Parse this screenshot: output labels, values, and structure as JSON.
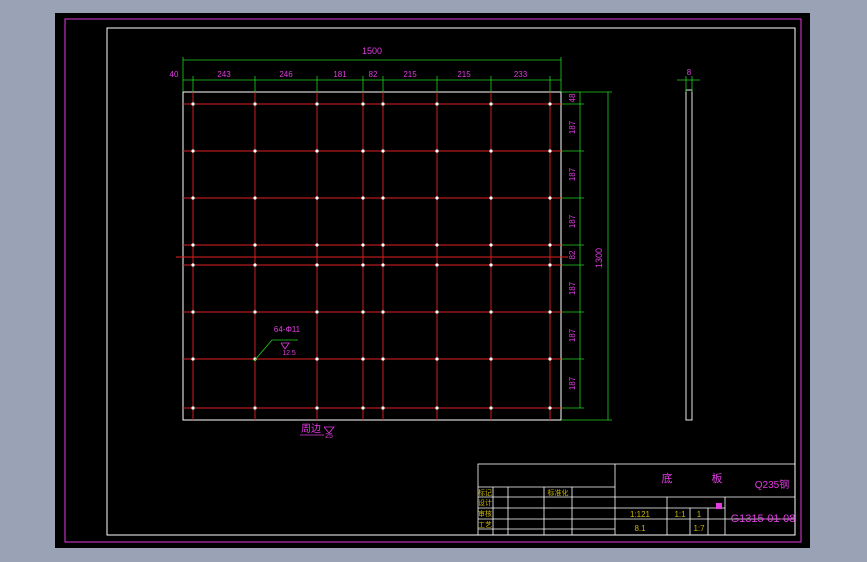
{
  "colors": {
    "background": "#9aa3b5",
    "paper": "#000000",
    "magenta": "#e23be2",
    "white": "#ffffff",
    "red": "#e02020",
    "green": "#20d020",
    "gold": "#c8b400"
  },
  "drawing": {
    "overall_width": "1500",
    "overall_height": "1300",
    "thickness": "8",
    "col_dims": [
      "40",
      "243",
      "246",
      "181",
      "82",
      "215",
      "215",
      "233"
    ],
    "row_dims": [
      "48",
      "187",
      "187",
      "187",
      "82",
      "187",
      "187",
      "187"
    ],
    "hole_callout": "64-Φ11",
    "hole_roughness": "12.5",
    "surface_note": "周边",
    "surface_roughness": "25"
  },
  "title_block": {
    "part_name_1": "底",
    "part_name_2": "板",
    "material": "Q235钢",
    "drawing_number": "G1315-01-08",
    "scale": "1:1",
    "sheet": "1",
    "scale2": "1:7",
    "left_labels": [
      "标记",
      "设计",
      "审核",
      "工艺"
    ],
    "col_label": "标准化",
    "small_1": "1:121",
    "small_2": "8.1"
  }
}
